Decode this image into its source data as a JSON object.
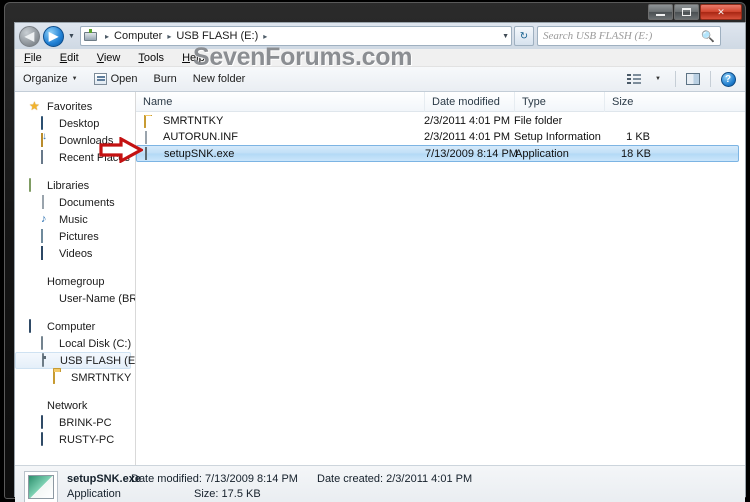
{
  "window": {
    "controls": {
      "minimize": "Minimize",
      "maximize": "Maximize",
      "close": "Close"
    }
  },
  "address": {
    "back_label": "Back",
    "forward_label": "Forward",
    "history_label": "Recent pages",
    "crumbs": [
      "Computer",
      "USB FLASH (E:)"
    ],
    "separator": "▸",
    "trailing_separator": "▸",
    "dropdown": "▼",
    "refresh": "↻"
  },
  "search": {
    "placeholder": "Search USB FLASH (E:)",
    "icon": "search-icon"
  },
  "menu": {
    "items": [
      {
        "label": "File",
        "accel": "F",
        "rest": "ile"
      },
      {
        "label": "Edit",
        "accel": "E",
        "rest": "dit"
      },
      {
        "label": "View",
        "accel": "V",
        "rest": "iew"
      },
      {
        "label": "Tools",
        "accel": "T",
        "rest": "ools"
      },
      {
        "label": "Help",
        "accel": "H",
        "rest": "elp"
      }
    ]
  },
  "toolbar": {
    "organize": "Organize",
    "organize_caret": "▼",
    "open": "Open",
    "burn": "Burn",
    "new_folder": "New folder",
    "views_caret": "▼",
    "help_glyph": "?"
  },
  "watermark": "SevenForums.com",
  "sidebar": {
    "groups": [
      {
        "header": {
          "label": "Favorites",
          "icon": "star-icon"
        },
        "children": [
          {
            "label": "Desktop",
            "icon": "desktop-icon"
          },
          {
            "label": "Downloads",
            "icon": "downloads-icon"
          },
          {
            "label": "Recent Places",
            "icon": "recent-places-icon"
          }
        ]
      },
      {
        "header": {
          "label": "Libraries",
          "icon": "libraries-icon"
        },
        "children": [
          {
            "label": "Documents",
            "icon": "documents-icon"
          },
          {
            "label": "Music",
            "icon": "music-icon"
          },
          {
            "label": "Pictures",
            "icon": "pictures-icon"
          },
          {
            "label": "Videos",
            "icon": "videos-icon"
          }
        ]
      },
      {
        "header": {
          "label": "Homegroup",
          "icon": "homegroup-icon"
        },
        "children": [
          {
            "label": "User-Name (BRINK-",
            "icon": "user-icon"
          }
        ]
      },
      {
        "header": {
          "label": "Computer",
          "icon": "computer-icon"
        },
        "children": [
          {
            "label": "Local Disk (C:)",
            "icon": "hard-disk-icon"
          },
          {
            "label": "USB FLASH (E:)",
            "icon": "usb-drive-icon",
            "selected": true
          },
          {
            "label": "SMRTNTKY",
            "icon": "folder-icon",
            "indent": 2
          }
        ]
      },
      {
        "header": {
          "label": "Network",
          "icon": "network-icon"
        },
        "children": [
          {
            "label": "BRINK-PC",
            "icon": "computer-node-icon"
          },
          {
            "label": "RUSTY-PC",
            "icon": "computer-node-icon"
          }
        ]
      }
    ]
  },
  "filelist": {
    "columns": [
      {
        "key": "name",
        "label": "Name"
      },
      {
        "key": "date",
        "label": "Date modified"
      },
      {
        "key": "type",
        "label": "Type"
      },
      {
        "key": "size",
        "label": "Size"
      }
    ],
    "rows": [
      {
        "name": "SMRTNTKY",
        "date": "2/3/2011 4:01 PM",
        "type": "File folder",
        "size": "",
        "icon": "folder-icon",
        "selected": false
      },
      {
        "name": "AUTORUN.INF",
        "date": "2/3/2011 4:01 PM",
        "type": "Setup Information",
        "size": "1 KB",
        "icon": "setup-information-icon",
        "selected": false
      },
      {
        "name": "setupSNK.exe",
        "date": "7/13/2009 8:14 PM",
        "type": "Application",
        "size": "18 KB",
        "icon": "application-icon",
        "selected": true
      }
    ]
  },
  "statusbar": {
    "filename": "setupSNK.exe",
    "date_modified_label": "Date modified:",
    "date_modified_value": "7/13/2009 8:14 PM",
    "date_created_label": "Date created:",
    "date_created_value": "2/3/2011 4:01 PM",
    "type": "Application",
    "size_label": "Size:",
    "size_value": "17.5 KB"
  },
  "annotation": {
    "arrow": "red-right-arrow",
    "color": "#c41212"
  }
}
